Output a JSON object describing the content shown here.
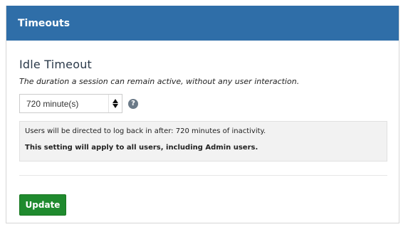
{
  "panel": {
    "title": "Timeouts"
  },
  "idle_timeout": {
    "heading": "Idle Timeout",
    "description": "The duration a session can remain active, without any user interaction.",
    "stepper_value": "720 minute(s)",
    "help_icon": "question-circle-icon",
    "info_line_1": "Users will be directed to log back in after: 720 minutes of inactivity.",
    "info_line_2": "This setting will apply to all users, including Admin users."
  },
  "actions": {
    "update_label": "Update"
  },
  "colors": {
    "header_bg": "#2f6ea8",
    "update_bg": "#1f8a2e",
    "info_bg": "#f2f2f2"
  }
}
